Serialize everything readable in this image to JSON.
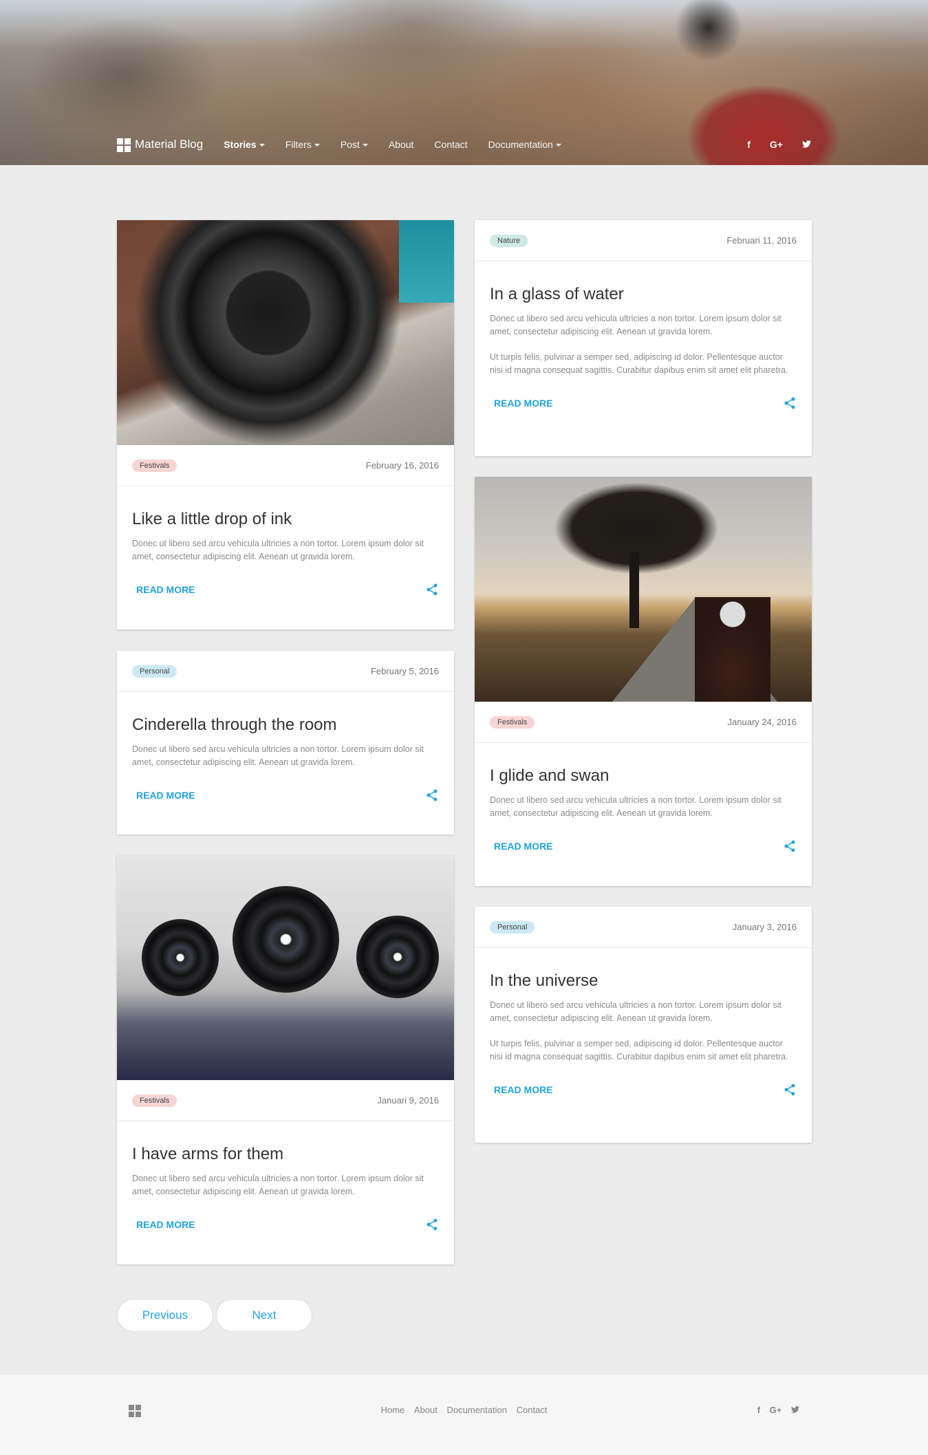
{
  "header": {
    "brand": "Material Blog",
    "nav": [
      {
        "label": "Stories",
        "dropdown": true,
        "active": true
      },
      {
        "label": "Filters",
        "dropdown": true
      },
      {
        "label": "Post",
        "dropdown": true
      },
      {
        "label": "About",
        "dropdown": false
      },
      {
        "label": "Contact",
        "dropdown": false
      },
      {
        "label": "Documentation",
        "dropdown": true
      }
    ],
    "social": [
      "f",
      "G+",
      "t"
    ]
  },
  "cards": [
    {
      "tag": "Festivals",
      "date": "February 16, 2016",
      "title": "Like a little drop of ink",
      "text": "Donec ut libero sed arcu vehicula ultricies a non tortor. Lorem ipsum dolor sit amet, consectetur adipiscing elit. Aenean ut gravida lorem.",
      "read_more": "READ MORE"
    },
    {
      "tag": "Personal",
      "date": "February 5, 2016",
      "title": "Cinderella through the room",
      "text": "Donec ut libero sed arcu vehicula ultricies a non tortor. Lorem ipsum dolor sit amet, consectetur adipiscing elit. Aenean ut gravida lorem.",
      "read_more": "READ MORE"
    },
    {
      "tag": "Festivals",
      "date": "Januari 9, 2016",
      "title": "I have arms for them",
      "text": "Donec ut libero sed arcu vehicula ultricies a non tortor. Lorem ipsum dolor sit amet, consectetur adipiscing elit. Aenean ut gravida lorem.",
      "read_more": "READ MORE"
    },
    {
      "tag": "Nature",
      "date": "Februari 11, 2016",
      "title": "In a glass of water",
      "text": "Donec ut libero sed arcu vehicula ultricies a non tortor. Lorem ipsum dolor sit amet, consectetur adipiscing elit. Aenean ut gravida lorem.",
      "text2": "Ut turpis felis, pulvinar a semper sed, adipiscing id dolor. Pellentesque auctor nisi id magna consequat sagittis. Curabitur dapibus enim sit amet elit pharetra.",
      "read_more": "READ MORE"
    },
    {
      "tag": "Festivals",
      "date": "January 24, 2016",
      "title": "I glide and swan",
      "text": "Donec ut libero sed arcu vehicula ultricies a non tortor. Lorem ipsum dolor sit amet, consectetur adipiscing elit. Aenean ut gravida lorem.",
      "read_more": "READ MORE"
    },
    {
      "tag": "Personal",
      "date": "January 3, 2016",
      "title": "In the universe",
      "text": "Donec ut libero sed arcu vehicula ultricies a non tortor. Lorem ipsum dolor sit amet, consectetur adipiscing elit. Aenean ut gravida lorem.",
      "text2": "Ut turpis felis, pulvinar a semper sed, adipiscing id dolor. Pellentesque auctor nisi id magna consequat sagittis. Curabitur dapibus enim sit amet elit pharetra.",
      "read_more": "READ MORE"
    }
  ],
  "pagination": {
    "previous": "Previous",
    "next": "Next"
  },
  "footer": {
    "links": [
      "Home",
      "About",
      "Documentation",
      "Contact"
    ],
    "social": [
      "f",
      "G+",
      "t"
    ]
  },
  "colors": {
    "accent": "#1ea3e0",
    "festivals_badge": "#f7d5d3",
    "personal_badge": "#cde8f5",
    "nature_badge": "#cfe9e4"
  }
}
